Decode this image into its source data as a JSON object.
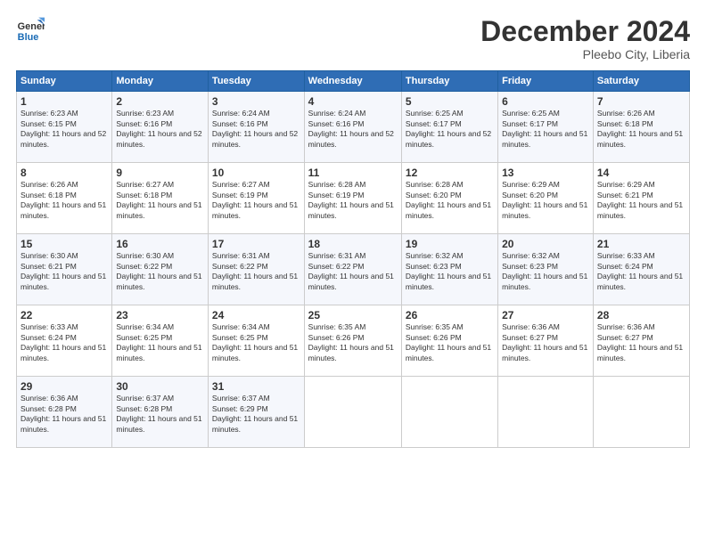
{
  "logo": {
    "line1": "General",
    "line2": "Blue"
  },
  "title": "December 2024",
  "subtitle": "Pleebo City, Liberia",
  "days_header": [
    "Sunday",
    "Monday",
    "Tuesday",
    "Wednesday",
    "Thursday",
    "Friday",
    "Saturday"
  ],
  "weeks": [
    [
      {
        "day": "1",
        "sunrise": "6:23 AM",
        "sunset": "6:15 PM",
        "daylight": "11 hours and 52 minutes."
      },
      {
        "day": "2",
        "sunrise": "6:23 AM",
        "sunset": "6:16 PM",
        "daylight": "11 hours and 52 minutes."
      },
      {
        "day": "3",
        "sunrise": "6:24 AM",
        "sunset": "6:16 PM",
        "daylight": "11 hours and 52 minutes."
      },
      {
        "day": "4",
        "sunrise": "6:24 AM",
        "sunset": "6:16 PM",
        "daylight": "11 hours and 52 minutes."
      },
      {
        "day": "5",
        "sunrise": "6:25 AM",
        "sunset": "6:17 PM",
        "daylight": "11 hours and 52 minutes."
      },
      {
        "day": "6",
        "sunrise": "6:25 AM",
        "sunset": "6:17 PM",
        "daylight": "11 hours and 51 minutes."
      },
      {
        "day": "7",
        "sunrise": "6:26 AM",
        "sunset": "6:18 PM",
        "daylight": "11 hours and 51 minutes."
      }
    ],
    [
      {
        "day": "8",
        "sunrise": "6:26 AM",
        "sunset": "6:18 PM",
        "daylight": "11 hours and 51 minutes."
      },
      {
        "day": "9",
        "sunrise": "6:27 AM",
        "sunset": "6:18 PM",
        "daylight": "11 hours and 51 minutes."
      },
      {
        "day": "10",
        "sunrise": "6:27 AM",
        "sunset": "6:19 PM",
        "daylight": "11 hours and 51 minutes."
      },
      {
        "day": "11",
        "sunrise": "6:28 AM",
        "sunset": "6:19 PM",
        "daylight": "11 hours and 51 minutes."
      },
      {
        "day": "12",
        "sunrise": "6:28 AM",
        "sunset": "6:20 PM",
        "daylight": "11 hours and 51 minutes."
      },
      {
        "day": "13",
        "sunrise": "6:29 AM",
        "sunset": "6:20 PM",
        "daylight": "11 hours and 51 minutes."
      },
      {
        "day": "14",
        "sunrise": "6:29 AM",
        "sunset": "6:21 PM",
        "daylight": "11 hours and 51 minutes."
      }
    ],
    [
      {
        "day": "15",
        "sunrise": "6:30 AM",
        "sunset": "6:21 PM",
        "daylight": "11 hours and 51 minutes."
      },
      {
        "day": "16",
        "sunrise": "6:30 AM",
        "sunset": "6:22 PM",
        "daylight": "11 hours and 51 minutes."
      },
      {
        "day": "17",
        "sunrise": "6:31 AM",
        "sunset": "6:22 PM",
        "daylight": "11 hours and 51 minutes."
      },
      {
        "day": "18",
        "sunrise": "6:31 AM",
        "sunset": "6:22 PM",
        "daylight": "11 hours and 51 minutes."
      },
      {
        "day": "19",
        "sunrise": "6:32 AM",
        "sunset": "6:23 PM",
        "daylight": "11 hours and 51 minutes."
      },
      {
        "day": "20",
        "sunrise": "6:32 AM",
        "sunset": "6:23 PM",
        "daylight": "11 hours and 51 minutes."
      },
      {
        "day": "21",
        "sunrise": "6:33 AM",
        "sunset": "6:24 PM",
        "daylight": "11 hours and 51 minutes."
      }
    ],
    [
      {
        "day": "22",
        "sunrise": "6:33 AM",
        "sunset": "6:24 PM",
        "daylight": "11 hours and 51 minutes."
      },
      {
        "day": "23",
        "sunrise": "6:34 AM",
        "sunset": "6:25 PM",
        "daylight": "11 hours and 51 minutes."
      },
      {
        "day": "24",
        "sunrise": "6:34 AM",
        "sunset": "6:25 PM",
        "daylight": "11 hours and 51 minutes."
      },
      {
        "day": "25",
        "sunrise": "6:35 AM",
        "sunset": "6:26 PM",
        "daylight": "11 hours and 51 minutes."
      },
      {
        "day": "26",
        "sunrise": "6:35 AM",
        "sunset": "6:26 PM",
        "daylight": "11 hours and 51 minutes."
      },
      {
        "day": "27",
        "sunrise": "6:36 AM",
        "sunset": "6:27 PM",
        "daylight": "11 hours and 51 minutes."
      },
      {
        "day": "28",
        "sunrise": "6:36 AM",
        "sunset": "6:27 PM",
        "daylight": "11 hours and 51 minutes."
      }
    ],
    [
      {
        "day": "29",
        "sunrise": "6:36 AM",
        "sunset": "6:28 PM",
        "daylight": "11 hours and 51 minutes."
      },
      {
        "day": "30",
        "sunrise": "6:37 AM",
        "sunset": "6:28 PM",
        "daylight": "11 hours and 51 minutes."
      },
      {
        "day": "31",
        "sunrise": "6:37 AM",
        "sunset": "6:29 PM",
        "daylight": "11 hours and 51 minutes."
      },
      null,
      null,
      null,
      null
    ]
  ],
  "labels": {
    "sunrise": "Sunrise:",
    "sunset": "Sunset:",
    "daylight": "Daylight:"
  }
}
